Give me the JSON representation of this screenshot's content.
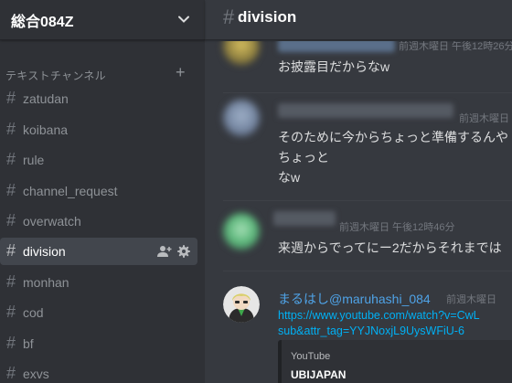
{
  "server": {
    "name": "総合084Z",
    "menu_icon": "chevron-down-icon"
  },
  "category": {
    "label": "テキストチャンネル",
    "add_icon": "plus-icon",
    "add_symbol": "+"
  },
  "channels": [
    {
      "hash": "#",
      "name": "zatudan",
      "active": false
    },
    {
      "hash": "#",
      "name": "koibana",
      "active": false
    },
    {
      "hash": "#",
      "name": "rule",
      "active": false
    },
    {
      "hash": "#",
      "name": "channel_request",
      "active": false
    },
    {
      "hash": "#",
      "name": "overwatch",
      "active": false
    },
    {
      "hash": "#",
      "name": "division",
      "active": true,
      "icons": [
        "add-user-icon",
        "gear-icon"
      ]
    },
    {
      "hash": "#",
      "name": "monhan",
      "active": false
    },
    {
      "hash": "#",
      "name": "cod",
      "active": false
    },
    {
      "hash": "#",
      "name": "bf",
      "active": false
    },
    {
      "hash": "#",
      "name": "exvs",
      "active": false
    }
  ],
  "channel_header": {
    "hash": "#",
    "title": "division"
  },
  "messages": [
    {
      "timestamp": "前週木曜日 午後12時26分",
      "lines": [
        "お披露目だからなw"
      ]
    },
    {
      "timestamp": "前週木曜日",
      "lines": [
        "そのために今からちょっと準備するんや",
        "ちょっと",
        "なw"
      ]
    },
    {
      "timestamp": "前週木曜日 午後12時46分",
      "lines": [
        "来週からでってにー2だからそれまでは"
      ]
    },
    {
      "author": "まるはし@maruhashi_084",
      "timestamp": "前週木曜日",
      "link_lines": [
        "https://www.youtube.com/watch?v=CwL",
        "sub&attr_tag=YYJNoxjL9UysWFiU-6"
      ],
      "embed": {
        "provider": "YouTube",
        "title": "UBIJAPAN"
      }
    }
  ],
  "colors": {
    "sidebar_bg": "#2f3136",
    "main_bg": "#36393f",
    "active_channel_bg": "#42464d",
    "author_color": "#4fa3e7",
    "link_color": "#00b0f4"
  }
}
